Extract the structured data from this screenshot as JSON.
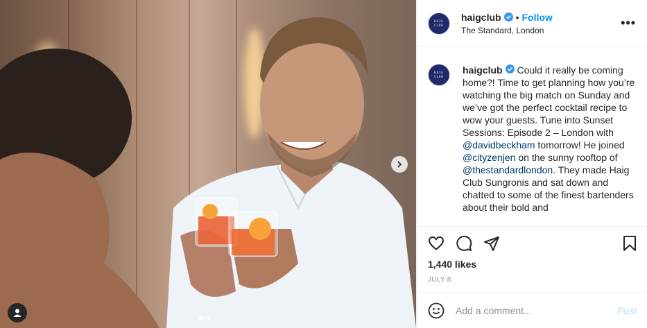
{
  "post": {
    "username": "haigclub",
    "follow_label": "Follow",
    "bullet": "•",
    "location": "The Standard, London",
    "more_label": "•••",
    "avatar_text": [
      "HAIG",
      "CLUB"
    ]
  },
  "caption": {
    "username": "haigclub",
    "segments": [
      {
        "text": " Could it really be coming home?! Time to get planning how you’re watching the big match on Sunday and we’ve got the perfect cocktail recipe to wow your guests. Tune into Sunset Sessions: Episode 2 – London with ",
        "mention": false
      },
      {
        "text": "@davidbeckham",
        "mention": true
      },
      {
        "text": " tomorrow! He joined ",
        "mention": false
      },
      {
        "text": "@cityzenjen",
        "mention": true
      },
      {
        "text": " on the sunny rooftop of ",
        "mention": false
      },
      {
        "text": "@thestandardlondon",
        "mention": true
      },
      {
        "text": ". They made Haig Club Sungronis and sat down and chatted to some of the finest bartenders about their bold and",
        "mention": false
      }
    ]
  },
  "stats": {
    "likes": "1,440 likes",
    "date": "JULY 8"
  },
  "comment": {
    "placeholder": "Add a comment...",
    "post_label": "Post"
  },
  "carousel": {
    "total": 2,
    "current": 1
  },
  "icons": {
    "verified": "verified-badge-icon",
    "like": "heart-icon",
    "comment": "comment-bubble-icon",
    "share": "paper-plane-icon",
    "save": "bookmark-icon",
    "emoji": "smiley-icon",
    "next": "chevron-right-icon",
    "tags": "user-tag-icon"
  },
  "colors": {
    "accent": "#0095f6",
    "verified": "#3897f0",
    "mention": "#00376b",
    "post_disabled": "#b2dffc",
    "avatar_bg": "#1f2a6b"
  }
}
